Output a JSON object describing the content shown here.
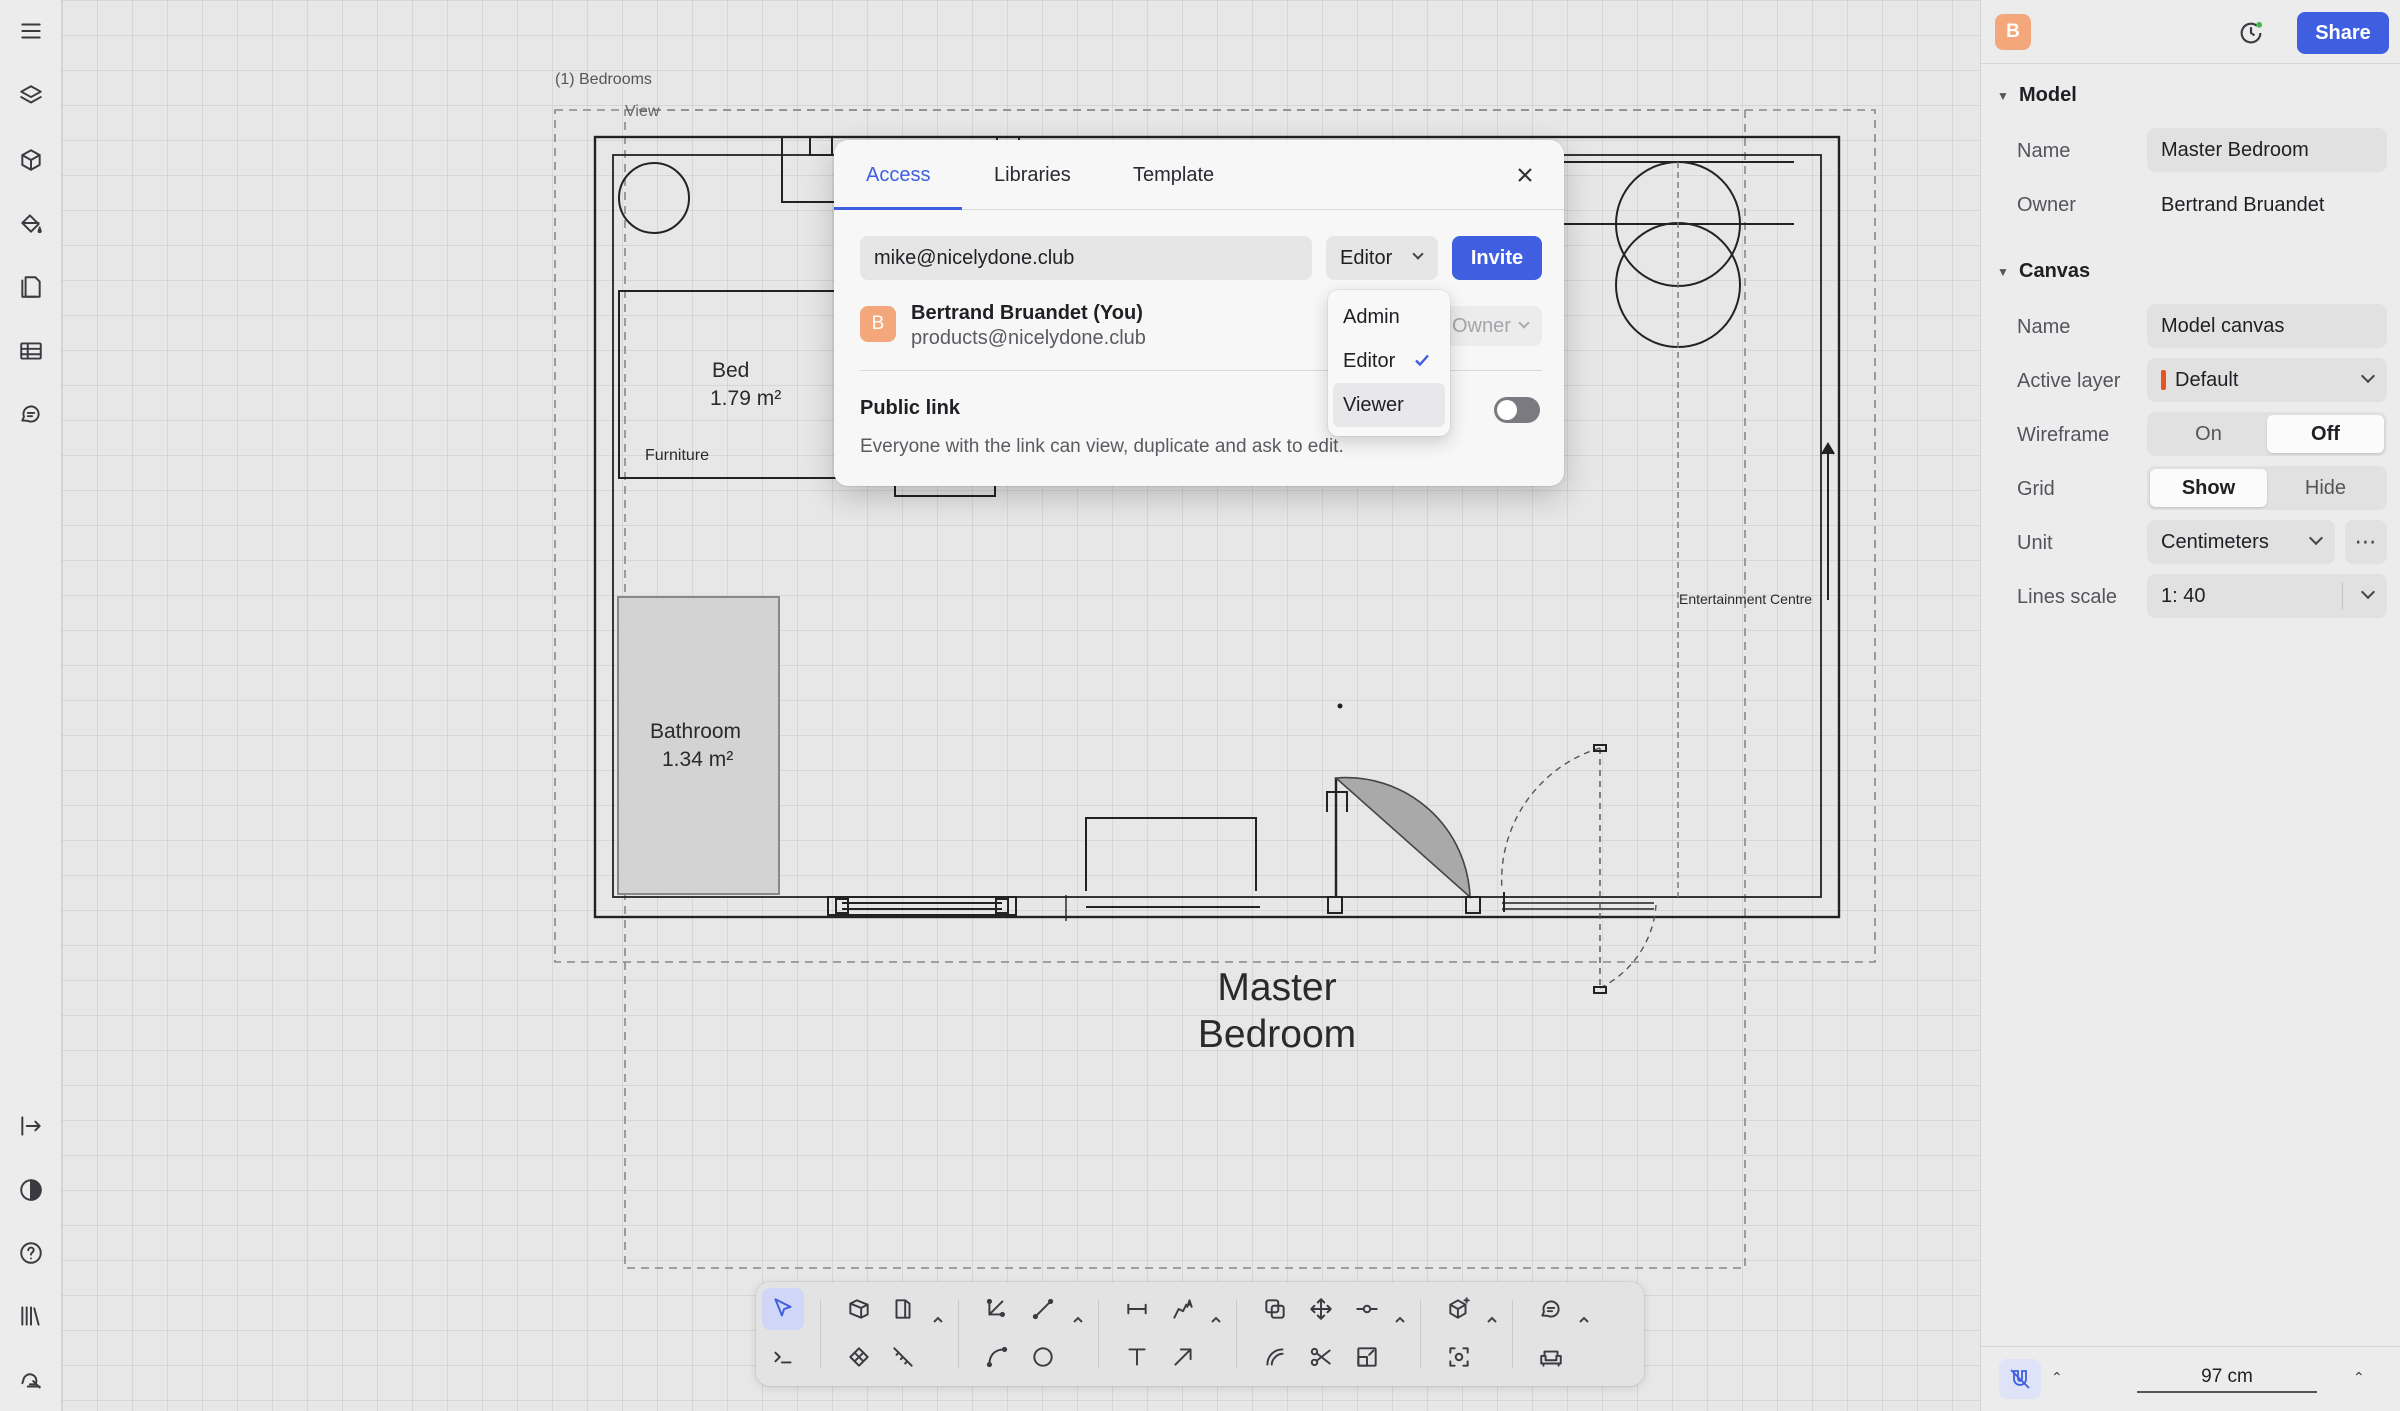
{
  "canvas": {
    "frame_label": "(1) Bedrooms",
    "view_label": "View",
    "rooms": {
      "bed": {
        "name": "Bed",
        "area": "1.79 m²"
      },
      "furniture": "Furniture",
      "bathroom": {
        "name": "Bathroom",
        "area": "1.34 m²"
      },
      "entertainment": "Entertainment Centre",
      "title_line1": "Master",
      "title_line2": "Bedroom"
    }
  },
  "share_dialog": {
    "tabs": [
      "Access",
      "Libraries",
      "Template"
    ],
    "active_tab": "Access",
    "invite_email": "mike@nicelydone.club",
    "role_selected": "Editor",
    "invite_label": "Invite",
    "member": {
      "avatar_initial": "B",
      "name": "Bertrand Bruandet (You)",
      "email": "products@nicelydone.club",
      "role": "Owner"
    },
    "public_link_title": "Public link",
    "public_link_desc": "Everyone with the link can view, duplicate and ask to edit.",
    "public_link_enabled": false,
    "role_menu": [
      "Admin",
      "Editor",
      "Viewer"
    ]
  },
  "right_panel": {
    "avatar_initial": "B",
    "share_label": "Share",
    "model_section": "Model",
    "model": {
      "name_label": "Name",
      "name_value": "Master Bedroom",
      "owner_label": "Owner",
      "owner_value": "Bertrand Bruandet"
    },
    "canvas_section": "Canvas",
    "canvas": {
      "name_label": "Name",
      "name_value": "Model canvas",
      "active_layer_label": "Active layer",
      "active_layer_value": "Default",
      "wireframe_label": "Wireframe",
      "wireframe_on": "On",
      "wireframe_off": "Off",
      "grid_label": "Grid",
      "grid_show": "Show",
      "grid_hide": "Hide",
      "unit_label": "Unit",
      "unit_value": "Centimeters",
      "lines_scale_label": "Lines scale",
      "lines_scale_value": "1: 40"
    },
    "scale_readout": "97 cm"
  },
  "colors": {
    "accent": "#3f5fe0",
    "avatar": "#f3a77a",
    "layer_swatch": "#e8561f"
  }
}
